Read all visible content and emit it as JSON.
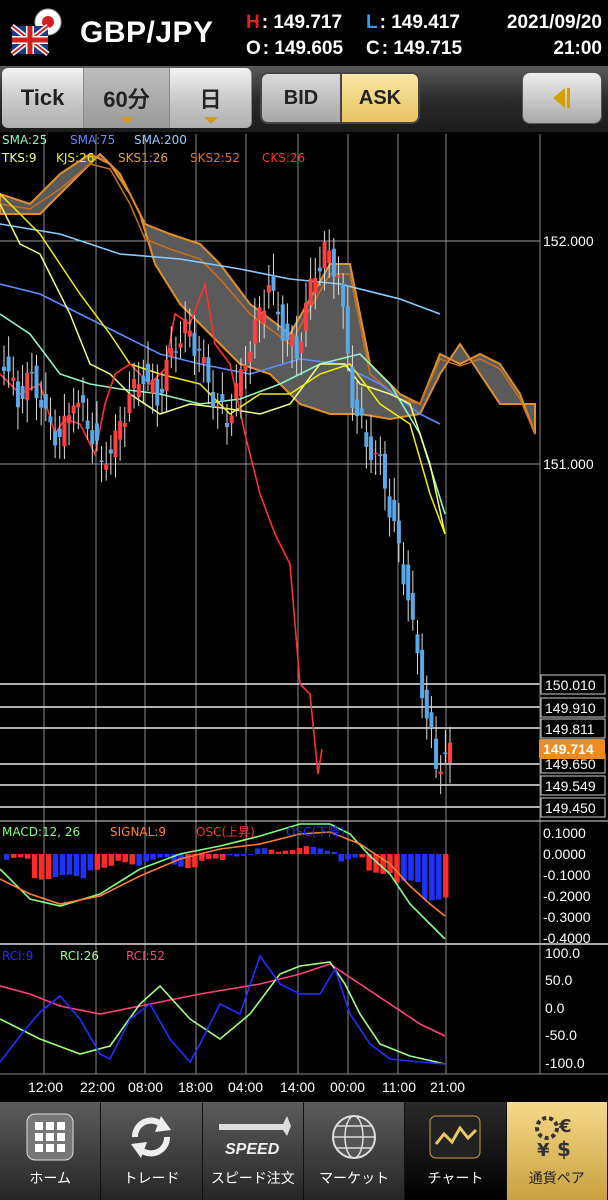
{
  "header": {
    "symbol": "GBP/JPY",
    "high_label": "H",
    "high_value": ": 149.717",
    "low_label": "L",
    "low_value": ": 149.417",
    "open_label": "O",
    "open_value": ": 149.605",
    "close_label": "C",
    "close_value": ": 149.715",
    "date": "2021/09/20",
    "time": "21:00",
    "high_color": "#e02020",
    "low_color": "#3a9be8"
  },
  "toolbar": {
    "tabs": [
      {
        "label": "Tick"
      },
      {
        "label": "60分",
        "selected": true
      },
      {
        "label": "日"
      }
    ],
    "bid_label": "BID",
    "ask_label": "ASK",
    "ask_selected": true,
    "collapse_icon": "left-collapse-icon"
  },
  "indicators": {
    "sma": [
      {
        "label": "SMA:25",
        "color": "#8cf5c0"
      },
      {
        "label": "SMA:75",
        "color": "#5a8cff"
      },
      {
        "label": "SMA:200",
        "color": "#88ccff"
      }
    ],
    "ichimoku": [
      {
        "label": "TKS:9",
        "color": "#f5ff80"
      },
      {
        "label": "KJS:26",
        "color": "#f0f000"
      },
      {
        "label": "SKS1:26",
        "color": "#e0a040"
      },
      {
        "label": "SKS2:52",
        "color": "#e07020"
      },
      {
        "label": "CKS:26",
        "color": "#ff3030"
      }
    ],
    "macd": [
      {
        "label": "MACD:12, 26",
        "color": "#80ff80"
      },
      {
        "label": "SIGNAL:9",
        "color": "#ff8030"
      },
      {
        "label": "OSC(上昇)",
        "color": "#ff3030"
      },
      {
        "label": "OSC(下降)",
        "color": "#2030ff"
      }
    ],
    "rci": [
      {
        "label": "RCI:9",
        "color": "#2030ff"
      },
      {
        "label": "RCI:26",
        "color": "#a0ff80"
      },
      {
        "label": "RCI:52",
        "color": "#ff4080"
      }
    ]
  },
  "price_axis": {
    "ticks": [
      "152.000",
      "151.000"
    ],
    "boxed_levels": [
      "150.010",
      "149.910",
      "149.811",
      "149.650",
      "149.549",
      "149.450"
    ],
    "current": "149.714",
    "current_color": "#f28a22"
  },
  "macd_axis": [
    "0.1000",
    "0.0000",
    "-0.1000",
    "-0.2000",
    "-0.3000",
    "-0.4000"
  ],
  "rci_axis": [
    "100.0",
    "50.0",
    "0.0",
    "-50.0",
    "-100.0"
  ],
  "time_axis": [
    "12:00",
    "22:00",
    "08:00",
    "18:00",
    "04:00",
    "14:00",
    "00:00",
    "11:00",
    "21:00"
  ],
  "chart_data": {
    "type": "candlestick",
    "instrument": "GBP/JPY",
    "interval": "60分",
    "price_range": [
      149.4,
      152.45
    ],
    "ohlc_last": {
      "open": 149.605,
      "high": 149.717,
      "low": 149.417,
      "close": 149.715
    },
    "close_series": [
      151.45,
      151.3,
      151.4,
      151.2,
      151.1,
      151.3,
      151.2,
      151.0,
      151.1,
      151.3,
      151.4,
      151.3,
      151.5,
      151.6,
      151.5,
      151.3,
      151.2,
      151.4,
      151.6,
      151.8,
      151.6,
      151.5,
      151.8,
      151.95,
      151.85,
      151.3,
      151.1,
      151.0,
      150.7,
      150.4,
      150.0,
      149.65,
      149.71
    ],
    "macd": [
      -0.05,
      -0.2,
      -0.2,
      -0.12,
      -0.08,
      -0.05,
      -0.1,
      -0.06,
      0.0,
      0.03,
      0.05,
      0.04,
      -0.05,
      -0.15,
      -0.25,
      -0.38
    ],
    "rci9": [
      -80,
      30,
      70,
      -60,
      60,
      -50,
      30,
      85,
      80,
      80,
      -60,
      -90,
      -95,
      -100
    ],
    "rci26": [
      0,
      -50,
      60,
      40,
      -30,
      60,
      60,
      80,
      60,
      -30,
      -90,
      -100
    ],
    "rci52": [
      10,
      -20,
      -30,
      -40,
      -20,
      0,
      30,
      60,
      40,
      0,
      -50,
      -80
    ]
  },
  "nav": {
    "items": [
      {
        "label": "ホーム",
        "icon": "home-grid-icon"
      },
      {
        "label": "トレード",
        "icon": "trade-refresh-icon"
      },
      {
        "label": "スピード注文",
        "icon": "speed-order-icon"
      },
      {
        "label": "マーケット",
        "icon": "market-globe-icon"
      },
      {
        "label": "チャート",
        "icon": "chart-icon",
        "active": true
      },
      {
        "label": "通貨ペア",
        "icon": "currency-pair-icon"
      }
    ],
    "speed_badge": "SPEED"
  }
}
